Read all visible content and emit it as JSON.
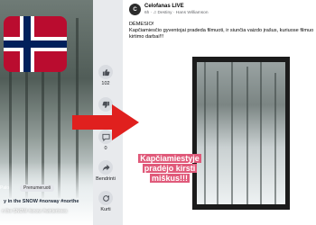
{
  "reel": {
    "follow_label": "Prenumeruoti",
    "left_label": "Palo",
    "caption": "y in the SNOW #norway #northe",
    "hashtags": "n the SNOW #snow #wintertrees"
  },
  "actions": {
    "likes": "102",
    "comments": "0",
    "share_label": "Bendrinti",
    "remix_label": "Kurti"
  },
  "post": {
    "avatar_letter": "C",
    "page_name": "Celofanas LIVE",
    "meta": "6h · ♫ Destiny · Hans Williamson",
    "text_line1": "DĖMESIO!",
    "text_line2": "Kapčiamiesčio gyventojai pradeda filmuoti, ir siunčia vaizdo įrašus, kuriuose filmuo",
    "text_line3": "kirtimo darbai!!!",
    "overlay_line1": "Kapčiamiestyje",
    "overlay_line2": "pradėjo kirsti",
    "overlay_line3": "miškus!!!"
  },
  "colors": {
    "arrow": "#e0201e",
    "overlay_bg": "#e05a7a",
    "flag_red": "#ba0c2f",
    "flag_blue": "#00205b"
  },
  "icons": [
    "thumbs-up-icon",
    "thumbs-down-icon",
    "comment-icon",
    "share-icon",
    "remix-icon"
  ]
}
